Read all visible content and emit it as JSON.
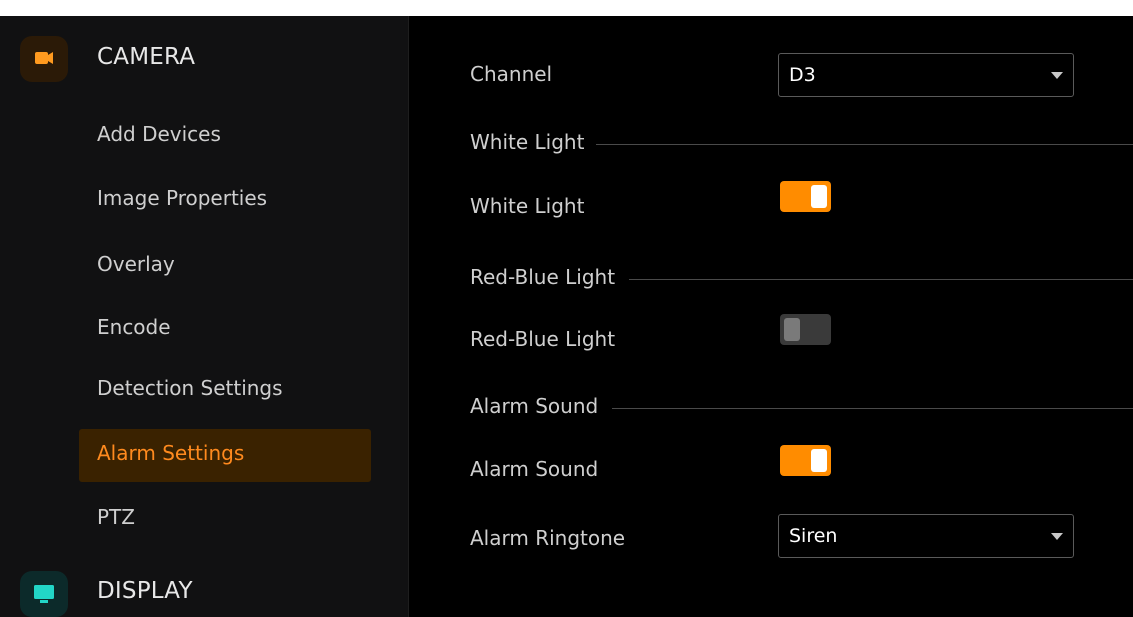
{
  "sidebar": {
    "categories": [
      {
        "label": "CAMERA",
        "icon": "camera-icon",
        "icon_bg": "#2b1a07",
        "icon_color": "#ff9a1f"
      },
      {
        "label": "DISPLAY",
        "icon": "monitor-icon",
        "icon_bg": "#0c2a2a",
        "icon_color": "#22d6c7"
      }
    ],
    "items": [
      {
        "label": "Add Devices",
        "active": false
      },
      {
        "label": "Image Properties",
        "active": false
      },
      {
        "label": "Overlay",
        "active": false
      },
      {
        "label": "Encode",
        "active": false
      },
      {
        "label": "Detection Settings",
        "active": false
      },
      {
        "label": "Alarm Settings",
        "active": true
      },
      {
        "label": "PTZ",
        "active": false
      }
    ]
  },
  "main": {
    "channel": {
      "label": "Channel",
      "value": "D3"
    },
    "white_light": {
      "section_title": "White Light",
      "toggle_label": "White Light",
      "enabled": true
    },
    "red_blue_light": {
      "section_title": "Red-Blue Light",
      "toggle_label": "Red-Blue Light",
      "enabled": false
    },
    "alarm_sound": {
      "section_title": "Alarm Sound",
      "toggle_label": "Alarm Sound",
      "enabled": true
    },
    "alarm_ringtone": {
      "label": "Alarm Ringtone",
      "value": "Siren"
    }
  },
  "colors": {
    "accent": "#ff8c00",
    "active_bg": "#3a2200",
    "active_text": "#ff8a1e"
  }
}
